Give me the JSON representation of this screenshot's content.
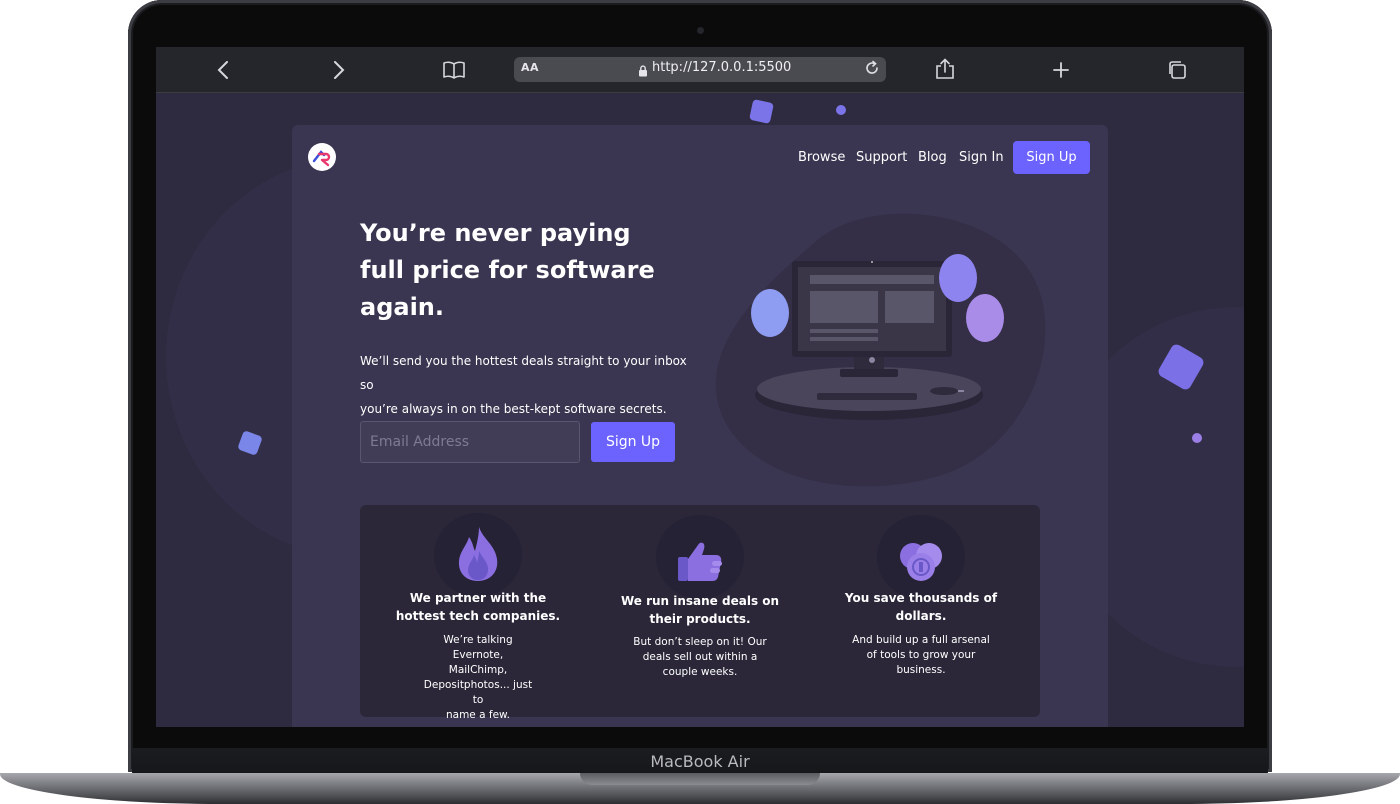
{
  "device": {
    "label": "MacBook Air"
  },
  "browser": {
    "text_size_label": "AA",
    "url": "http://127.0.0.1:5500",
    "icons": [
      "back-icon",
      "forward-icon",
      "bookmarks-icon",
      "lock-icon",
      "reload-icon",
      "share-icon",
      "new-tab-icon",
      "tabs-icon"
    ]
  },
  "nav": {
    "links": [
      "Browse",
      "Support",
      "Blog",
      "Sign In"
    ],
    "signup": "Sign Up"
  },
  "hero": {
    "headline_lines": [
      "You’re never paying",
      "full price for software",
      "again."
    ],
    "subtext_lines": [
      "We’ll send you the hottest deals straight to your inbox so",
      "you’re always in on the best-kept software secrets."
    ],
    "email_placeholder": "Email Address",
    "cta": "Sign Up"
  },
  "features": [
    {
      "icon": "flame-icon",
      "title_lines": [
        "We partner with the",
        "hottest tech companies."
      ],
      "desc_lines": [
        "We’re talking Evernote,",
        "MailChimp,",
        "Depositphotos... just to",
        "name a few."
      ]
    },
    {
      "icon": "thumbs-up-icon",
      "title_lines": [
        "We run insane deals on",
        "their products."
      ],
      "desc_lines": [
        "But don’t sleep on it! Our",
        "deals sell out within a",
        "couple weeks."
      ]
    },
    {
      "icon": "coins-icon",
      "title_lines": [
        "You save thousands of",
        "dollars."
      ],
      "desc_lines": [
        "And build up a full arsenal",
        "of tools to grow your",
        "business."
      ]
    }
  ],
  "colors": {
    "accent": "#6c63ff",
    "page_bg": "#2e2a3f",
    "card_bg": "#3a3550",
    "feature_bg": "#2b2739"
  }
}
